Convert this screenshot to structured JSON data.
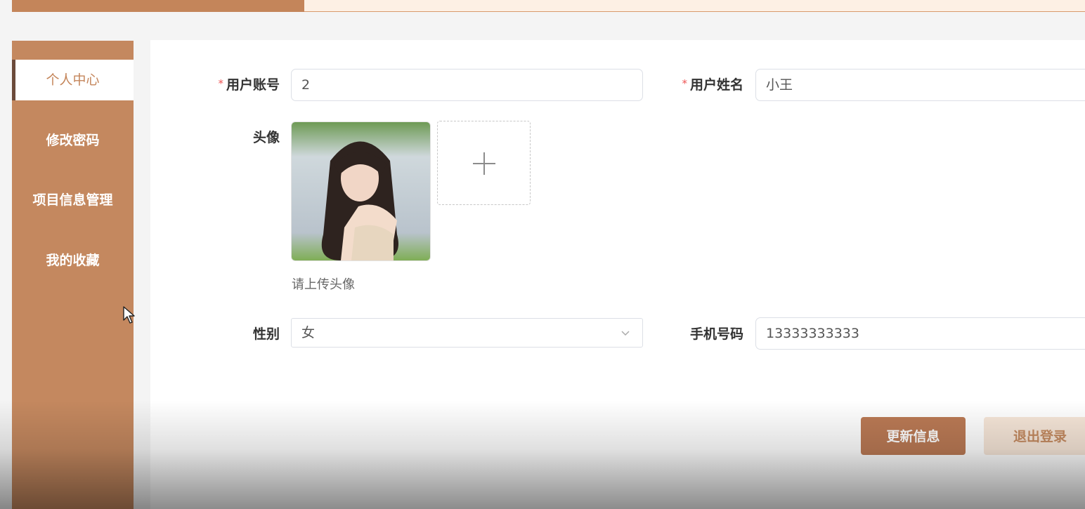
{
  "sidebar": {
    "items": [
      {
        "label": "个人中心",
        "active": true
      },
      {
        "label": "修改密码",
        "active": false
      },
      {
        "label": "项目信息管理",
        "active": false
      },
      {
        "label": "我的收藏",
        "active": false
      }
    ]
  },
  "form": {
    "account": {
      "label": "用户账号",
      "required_mark": "*",
      "value": "2"
    },
    "name": {
      "label": "用户姓名",
      "required_mark": "*",
      "value": "小王"
    },
    "avatar": {
      "label": "头像",
      "hint": "请上传头像"
    },
    "gender": {
      "label": "性别",
      "value": "女"
    },
    "phone": {
      "label": "手机号码",
      "value": "13333333333"
    }
  },
  "buttons": {
    "update": "更新信息",
    "logout": "退出登录"
  },
  "colors": {
    "accent": "#c4855a",
    "sidebar_bg": "#c4885f",
    "required": "#ee5555"
  }
}
